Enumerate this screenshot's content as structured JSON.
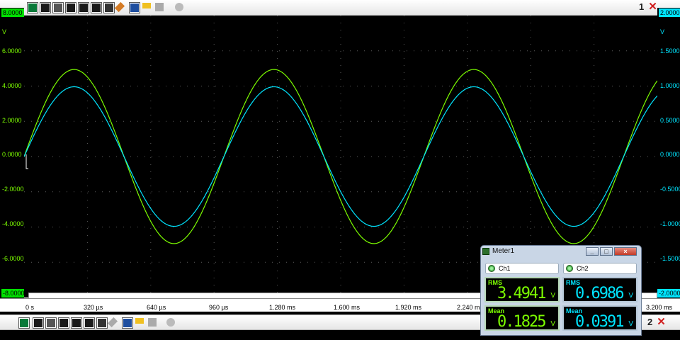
{
  "top_toolbar": {
    "scope_number": "1"
  },
  "bottom_toolbar": {
    "scope_number": "2"
  },
  "y_left": {
    "color": "#7cfc00",
    "top_value": "8.0000",
    "unit": "V",
    "ticks": [
      "6.0000",
      "4.0000",
      "2.0000",
      "0.0000",
      "-2.0000",
      "-4.0000",
      "-6.0000"
    ],
    "bottom_value": "-8.0000"
  },
  "y_right": {
    "color": "#00e5ff",
    "top_value": "2.0000",
    "unit": "V",
    "ticks": [
      "1.5000",
      "1.0000",
      "0.5000",
      "0.0000",
      "-0.5000",
      "-1.0000",
      "-1.5000"
    ],
    "bottom_value": "-2.0000"
  },
  "x_axis": {
    "labels": [
      "0 s",
      "320 µs",
      "640 µs",
      "960 µs",
      "1.280 ms",
      "1.600 ms",
      "1.920 ms",
      "2.240 ms",
      "3.200 ms"
    ]
  },
  "chart_data": {
    "type": "line",
    "x_unit": "s",
    "xlim": [
      0,
      0.0032
    ],
    "grid": true,
    "series": [
      {
        "name": "Ch1",
        "color": "#7cfc00",
        "ylim": [
          -8,
          8
        ],
        "amplitude": 4.94,
        "offset": 0.0,
        "period": 0.00101,
        "phase": 0
      },
      {
        "name": "Ch2",
        "color": "#00e5ff",
        "ylim": [
          -2,
          2
        ],
        "amplitude": 0.99,
        "offset": 0.0,
        "period": 0.00101,
        "phase": 0
      }
    ]
  },
  "meter": {
    "title": "Meter1",
    "btn_min": "_",
    "btn_max": "□",
    "btn_close": "×",
    "tabs": [
      "Ch1",
      "Ch2"
    ],
    "ch1": {
      "rms_label": "RMS",
      "rms_value": "3.4941",
      "rms_unit": "V",
      "mean_label": "Mean",
      "mean_value": "0.1825",
      "mean_unit": "V"
    },
    "ch2": {
      "rms_label": "RMS",
      "rms_value": "0.6986",
      "rms_unit": "V",
      "mean_label": "Mean",
      "mean_value": "0.0391",
      "mean_unit": "V"
    }
  }
}
